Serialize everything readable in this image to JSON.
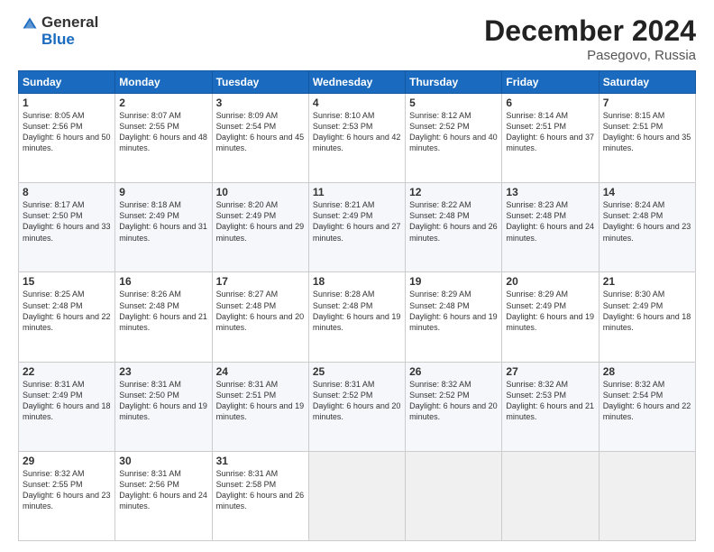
{
  "header": {
    "logo_general": "General",
    "logo_blue": "Blue",
    "title": "December 2024",
    "location": "Pasegovo, Russia"
  },
  "days_of_week": [
    "Sunday",
    "Monday",
    "Tuesday",
    "Wednesday",
    "Thursday",
    "Friday",
    "Saturday"
  ],
  "weeks": [
    [
      {
        "day": "1",
        "sunrise": "Sunrise: 8:05 AM",
        "sunset": "Sunset: 2:56 PM",
        "daylight": "Daylight: 6 hours and 50 minutes."
      },
      {
        "day": "2",
        "sunrise": "Sunrise: 8:07 AM",
        "sunset": "Sunset: 2:55 PM",
        "daylight": "Daylight: 6 hours and 48 minutes."
      },
      {
        "day": "3",
        "sunrise": "Sunrise: 8:09 AM",
        "sunset": "Sunset: 2:54 PM",
        "daylight": "Daylight: 6 hours and 45 minutes."
      },
      {
        "day": "4",
        "sunrise": "Sunrise: 8:10 AM",
        "sunset": "Sunset: 2:53 PM",
        "daylight": "Daylight: 6 hours and 42 minutes."
      },
      {
        "day": "5",
        "sunrise": "Sunrise: 8:12 AM",
        "sunset": "Sunset: 2:52 PM",
        "daylight": "Daylight: 6 hours and 40 minutes."
      },
      {
        "day": "6",
        "sunrise": "Sunrise: 8:14 AM",
        "sunset": "Sunset: 2:51 PM",
        "daylight": "Daylight: 6 hours and 37 minutes."
      },
      {
        "day": "7",
        "sunrise": "Sunrise: 8:15 AM",
        "sunset": "Sunset: 2:51 PM",
        "daylight": "Daylight: 6 hours and 35 minutes."
      }
    ],
    [
      {
        "day": "8",
        "sunrise": "Sunrise: 8:17 AM",
        "sunset": "Sunset: 2:50 PM",
        "daylight": "Daylight: 6 hours and 33 minutes."
      },
      {
        "day": "9",
        "sunrise": "Sunrise: 8:18 AM",
        "sunset": "Sunset: 2:49 PM",
        "daylight": "Daylight: 6 hours and 31 minutes."
      },
      {
        "day": "10",
        "sunrise": "Sunrise: 8:20 AM",
        "sunset": "Sunset: 2:49 PM",
        "daylight": "Daylight: 6 hours and 29 minutes."
      },
      {
        "day": "11",
        "sunrise": "Sunrise: 8:21 AM",
        "sunset": "Sunset: 2:49 PM",
        "daylight": "Daylight: 6 hours and 27 minutes."
      },
      {
        "day": "12",
        "sunrise": "Sunrise: 8:22 AM",
        "sunset": "Sunset: 2:48 PM",
        "daylight": "Daylight: 6 hours and 26 minutes."
      },
      {
        "day": "13",
        "sunrise": "Sunrise: 8:23 AM",
        "sunset": "Sunset: 2:48 PM",
        "daylight": "Daylight: 6 hours and 24 minutes."
      },
      {
        "day": "14",
        "sunrise": "Sunrise: 8:24 AM",
        "sunset": "Sunset: 2:48 PM",
        "daylight": "Daylight: 6 hours and 23 minutes."
      }
    ],
    [
      {
        "day": "15",
        "sunrise": "Sunrise: 8:25 AM",
        "sunset": "Sunset: 2:48 PM",
        "daylight": "Daylight: 6 hours and 22 minutes."
      },
      {
        "day": "16",
        "sunrise": "Sunrise: 8:26 AM",
        "sunset": "Sunset: 2:48 PM",
        "daylight": "Daylight: 6 hours and 21 minutes."
      },
      {
        "day": "17",
        "sunrise": "Sunrise: 8:27 AM",
        "sunset": "Sunset: 2:48 PM",
        "daylight": "Daylight: 6 hours and 20 minutes."
      },
      {
        "day": "18",
        "sunrise": "Sunrise: 8:28 AM",
        "sunset": "Sunset: 2:48 PM",
        "daylight": "Daylight: 6 hours and 19 minutes."
      },
      {
        "day": "19",
        "sunrise": "Sunrise: 8:29 AM",
        "sunset": "Sunset: 2:48 PM",
        "daylight": "Daylight: 6 hours and 19 minutes."
      },
      {
        "day": "20",
        "sunrise": "Sunrise: 8:29 AM",
        "sunset": "Sunset: 2:49 PM",
        "daylight": "Daylight: 6 hours and 19 minutes."
      },
      {
        "day": "21",
        "sunrise": "Sunrise: 8:30 AM",
        "sunset": "Sunset: 2:49 PM",
        "daylight": "Daylight: 6 hours and 18 minutes."
      }
    ],
    [
      {
        "day": "22",
        "sunrise": "Sunrise: 8:31 AM",
        "sunset": "Sunset: 2:49 PM",
        "daylight": "Daylight: 6 hours and 18 minutes."
      },
      {
        "day": "23",
        "sunrise": "Sunrise: 8:31 AM",
        "sunset": "Sunset: 2:50 PM",
        "daylight": "Daylight: 6 hours and 19 minutes."
      },
      {
        "day": "24",
        "sunrise": "Sunrise: 8:31 AM",
        "sunset": "Sunset: 2:51 PM",
        "daylight": "Daylight: 6 hours and 19 minutes."
      },
      {
        "day": "25",
        "sunrise": "Sunrise: 8:31 AM",
        "sunset": "Sunset: 2:52 PM",
        "daylight": "Daylight: 6 hours and 20 minutes."
      },
      {
        "day": "26",
        "sunrise": "Sunrise: 8:32 AM",
        "sunset": "Sunset: 2:52 PM",
        "daylight": "Daylight: 6 hours and 20 minutes."
      },
      {
        "day": "27",
        "sunrise": "Sunrise: 8:32 AM",
        "sunset": "Sunset: 2:53 PM",
        "daylight": "Daylight: 6 hours and 21 minutes."
      },
      {
        "day": "28",
        "sunrise": "Sunrise: 8:32 AM",
        "sunset": "Sunset: 2:54 PM",
        "daylight": "Daylight: 6 hours and 22 minutes."
      }
    ],
    [
      {
        "day": "29",
        "sunrise": "Sunrise: 8:32 AM",
        "sunset": "Sunset: 2:55 PM",
        "daylight": "Daylight: 6 hours and 23 minutes."
      },
      {
        "day": "30",
        "sunrise": "Sunrise: 8:31 AM",
        "sunset": "Sunset: 2:56 PM",
        "daylight": "Daylight: 6 hours and 24 minutes."
      },
      {
        "day": "31",
        "sunrise": "Sunrise: 8:31 AM",
        "sunset": "Sunset: 2:58 PM",
        "daylight": "Daylight: 6 hours and 26 minutes."
      },
      null,
      null,
      null,
      null
    ]
  ]
}
